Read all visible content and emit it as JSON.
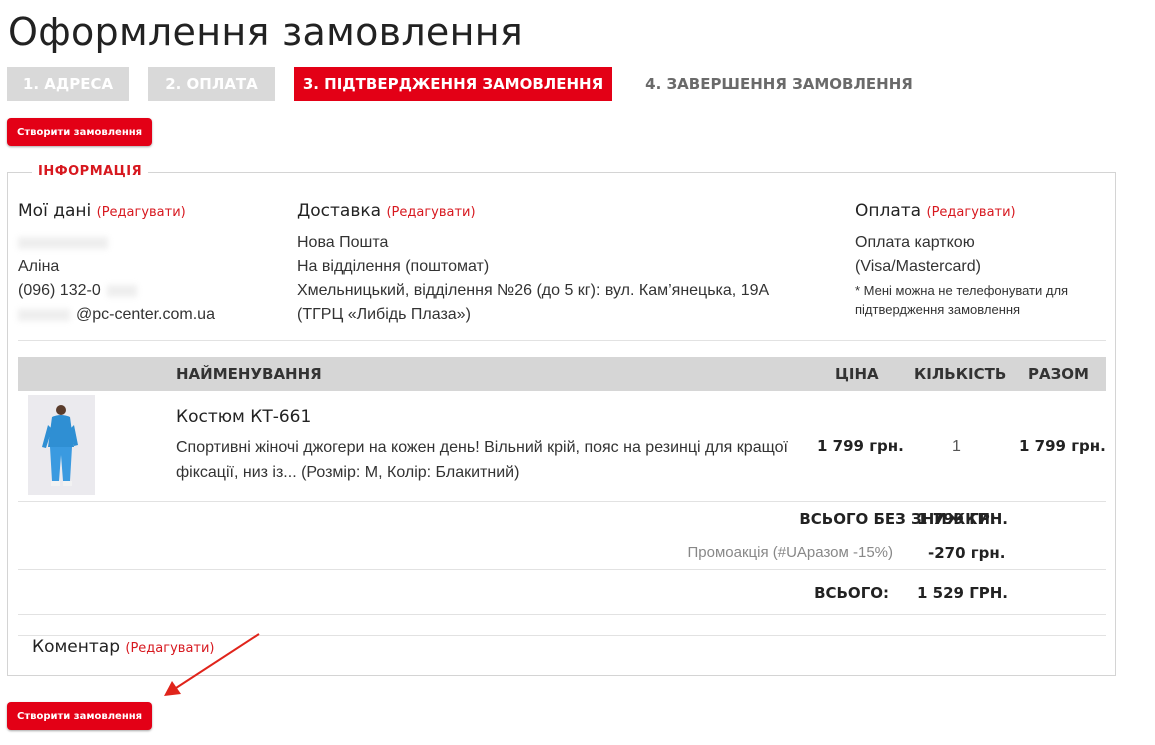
{
  "page_title": "Оформлення замовлення",
  "steps": [
    {
      "label": "1. АДРЕСА",
      "state": "done"
    },
    {
      "label": "2. ОПЛАТА",
      "state": "done"
    },
    {
      "label": "3. ПІДТВЕРДЖЕННЯ ЗАМОВЛЕННЯ",
      "state": "active"
    },
    {
      "label": "4. ЗАВЕРШЕННЯ ЗАМОВЛЕННЯ",
      "state": "todo"
    }
  ],
  "create_button_label": "Створити замовлення",
  "info": {
    "legend": "ІНФОРМАЦІЯ",
    "edit_label": "(Редагувати)",
    "my_data": {
      "title": "Мої дані",
      "name": "Аліна",
      "phone": "(096) 132-0",
      "email": "@pc-center.com.ua"
    },
    "delivery": {
      "title": "Доставка",
      "line1": "Нова Пошта",
      "line2": "На відділення (поштомат)",
      "line3": "Хмельницький, відділення №26 (до 5 кг): вул. Кам’янецька, 19А",
      "line4": "(ТГРЦ «Либідь Плаза»)"
    },
    "payment": {
      "title": "Оплата",
      "line1": "Оплата карткою",
      "line2": "(Visa/Mastercard)",
      "note": "* Мені можна не телефонувати для підтвердження замовлення"
    }
  },
  "table": {
    "headers": {
      "name": "НАЙМЕНУВАННЯ",
      "price": "ЦІНА",
      "qty": "КІЛЬКІСТЬ",
      "total": "РАЗОМ"
    },
    "item": {
      "name": "Костюм КТ-661",
      "description": "Спортивні жіночі джогери на кожен день! Вільний крій, пояс на резинці для кращої фіксації, низ із... (Розмір: M, Колір: Блакитний)",
      "price": "1 799 грн.",
      "qty": "1",
      "total": "1 799 грн."
    },
    "subtotal_label": "ВСЬОГО БЕЗ ЗНИЖКИ:",
    "subtotal_value": "1 799 ГРН.",
    "promo_label": "Промоакція (#UAразом -15%)",
    "promo_value": "-270 грн.",
    "grand_label": "ВСЬОГО:",
    "grand_value": "1 529 ГРН."
  },
  "comment": {
    "title": "Коментар",
    "edit_label": "(Редагувати)"
  },
  "colors": {
    "accent": "#e30016",
    "step_done": "#d9d9d9",
    "header_row": "#d6d6d6"
  }
}
